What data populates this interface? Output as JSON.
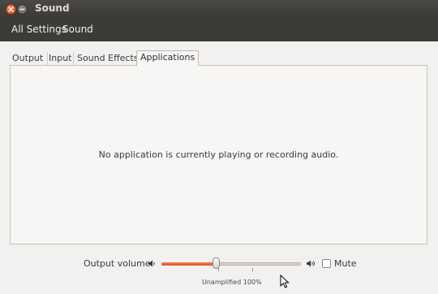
{
  "window": {
    "title": "Sound"
  },
  "toolbar": {
    "all_settings_label": "All Settings",
    "sound_label": "Sound"
  },
  "tabs": [
    {
      "label": "Output",
      "active": false
    },
    {
      "label": "Input",
      "active": false
    },
    {
      "label": "Sound Effects",
      "active": false
    },
    {
      "label": "Applications",
      "active": true
    }
  ],
  "applications_panel": {
    "empty_message": "No application is currently playing or recording audio."
  },
  "output_volume": {
    "label": "Output volume:",
    "level_percent": 39,
    "tick_mark_label": "Unamplified 100%",
    "mute_label": "Mute",
    "mute_checked": false
  },
  "icons": {
    "close": "close-icon",
    "minimize": "minimize-icon",
    "volume_low": "speaker-low-icon",
    "volume_high": "speaker-high-icon",
    "pointer": "mouse-pointer-icon"
  },
  "colors": {
    "titlebar": "#3c3b37",
    "accent_orange": "#dd4814",
    "content_bg": "#f2f1f0"
  }
}
